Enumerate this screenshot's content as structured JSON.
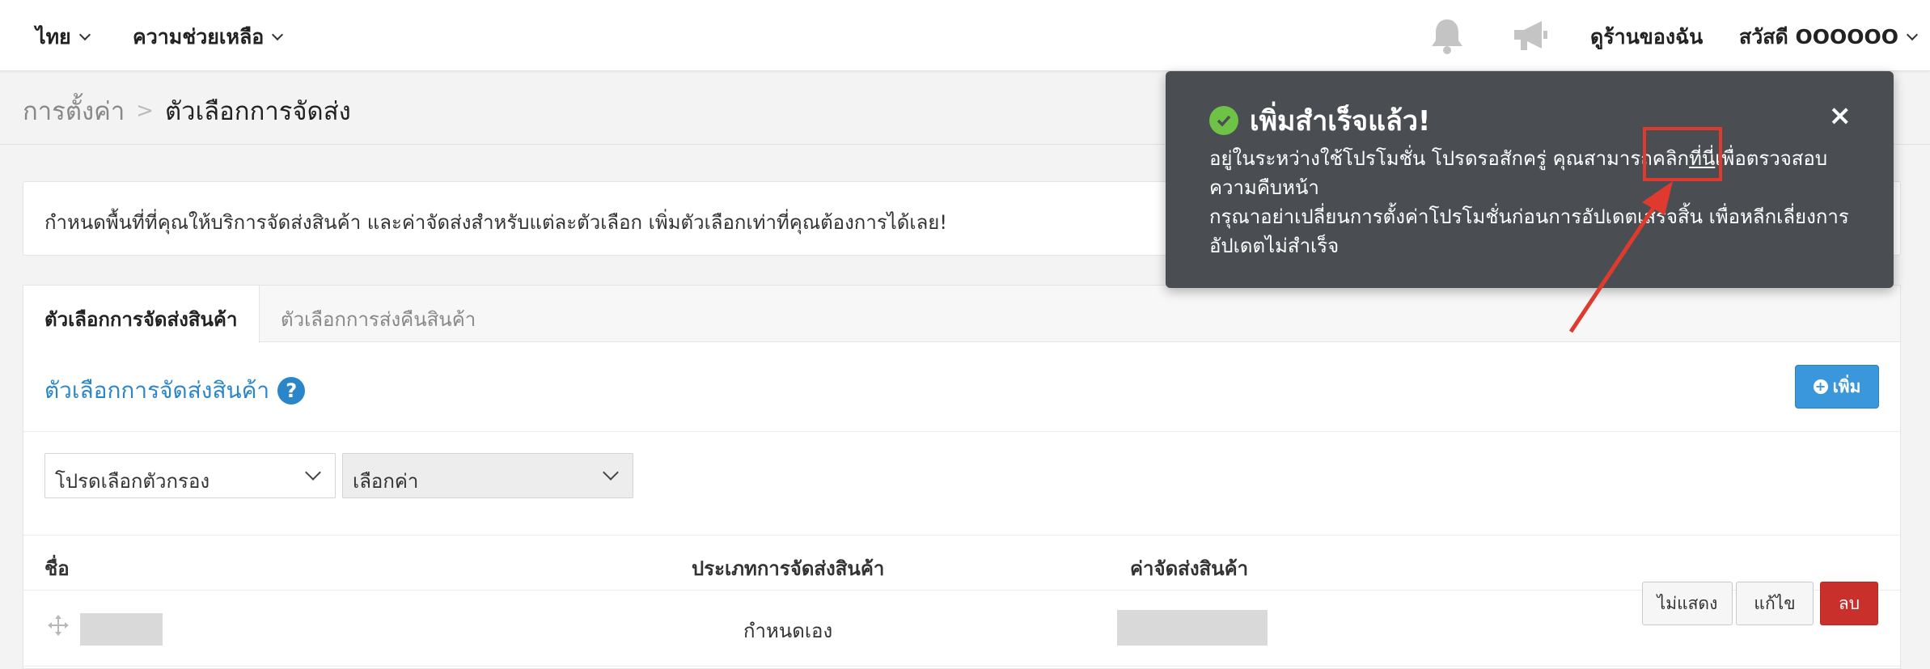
{
  "topbar": {
    "language": "ไทย",
    "help": "ความช่วยเหลือ",
    "my_shop": "ดูร้านของฉัน",
    "greeting": "สวัสดี OOOOOO"
  },
  "breadcrumb": {
    "root": "การตั้งค่า",
    "separator": ">",
    "current": "ตัวเลือกการจัดส่ง"
  },
  "info": {
    "text": "กำหนดพื้นที่ที่คุณให้บริการจัดส่งสินค้า และค่าจัดส่งสำหรับแต่ละตัวเลือก เพิ่มตัวเลือกเท่าที่คุณต้องการได้เลย!"
  },
  "tabs": [
    {
      "label": "ตัวเลือกการจัดส่งสินค้า",
      "active": true
    },
    {
      "label": "ตัวเลือกการส่งคืนสินค้า",
      "active": false
    }
  ],
  "section": {
    "title": "ตัวเลือกการจัดส่งสินค้า",
    "help_glyph": "?",
    "add_label": "เพิ่ม"
  },
  "filters": {
    "filter_select": "โปรดเลือกตัวกรอง",
    "value_select": "เลือกค่า"
  },
  "table": {
    "headers": [
      "ชื่อ",
      "ประเภทการจัดส่งสินค้า",
      "ค่าจัดส่งสินค้า"
    ],
    "rows": [
      {
        "type": "กำหนดเอง",
        "actions": [
          "ไม่แสดง",
          "แก้ไข",
          "ลบ"
        ]
      }
    ]
  },
  "toast": {
    "title": "เพิ่มสำเร็จแล้ว!",
    "close_glyph": "×",
    "line1_before": "อยู่ในระหว่างใช้โปรโมชั่น โปรดรอสักครู่ คุณสามารถคลิก",
    "line1_link": "ที่นี่",
    "line1_after": "เพื่อตรวจสอบความคืบหน้า",
    "line2": "กรุณาอย่าเปลี่ยนการตั้งค่าโปรโมชั่นก่อนการอัปเดตเสร็จสิ้น เพื่อหลีกเลี่ยงการอัปเดตไม่สำเร็จ"
  },
  "colors": {
    "accent_blue": "#2b86c9",
    "button_blue": "#3a97db",
    "danger_red": "#c9302c",
    "toast_bg": "#4a4e53",
    "success_green": "#6ec245",
    "annotation_red": "#e03a2f"
  }
}
